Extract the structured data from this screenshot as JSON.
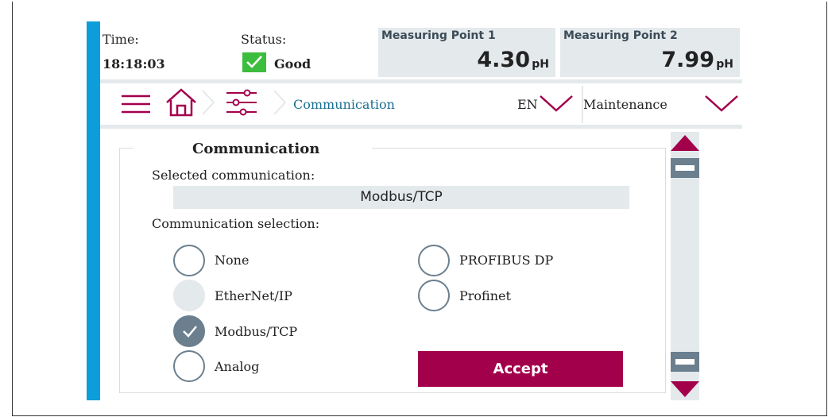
{
  "status_bar": {
    "time_label": "Time:",
    "time_value": "18:18:03",
    "status_label": "Status:",
    "status_value": "Good"
  },
  "measuring_points": [
    {
      "title": "Measuring Point 1",
      "value": "4.30",
      "unit": "pH"
    },
    {
      "title": "Measuring Point 2",
      "value": "7.99",
      "unit": "pH"
    }
  ],
  "nav": {
    "icons": [
      "menu-icon",
      "home-icon",
      "settings-sliders-icon"
    ],
    "breadcrumb_current": "Communication",
    "language": "EN",
    "role": "Maintenance"
  },
  "panel": {
    "title": "Communication",
    "selected_label": "Selected communication:",
    "selected_value": "Modbus/TCP",
    "selection_label": "Communication selection:",
    "options": [
      {
        "label": "None",
        "state": "unchecked"
      },
      {
        "label": "EtherNet/IP",
        "state": "disabled"
      },
      {
        "label": "Modbus/TCP",
        "state": "checked"
      },
      {
        "label": "Analog",
        "state": "unchecked"
      },
      {
        "label": "PROFIBUS DP",
        "state": "unchecked"
      },
      {
        "label": "Profinet",
        "state": "unchecked"
      }
    ],
    "accept_label": "Accept"
  },
  "colors": {
    "accent": "#a3004c",
    "side_bar": "#0c9ddb",
    "panel_gray": "#e4e9ec",
    "good": "#3dbd3d",
    "radio_gray": "#6b7f8e"
  }
}
